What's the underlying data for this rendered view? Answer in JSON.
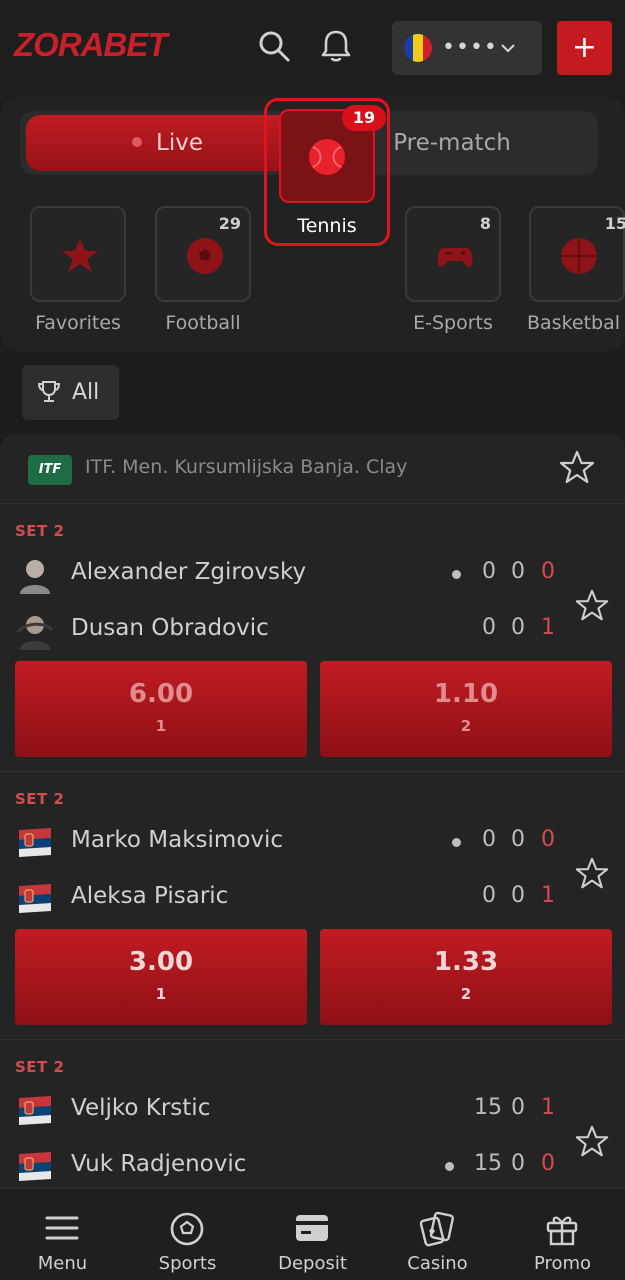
{
  "header": {
    "logo": "ZORABET",
    "balance_masked": "••••",
    "add_label": "+"
  },
  "tabs": [
    {
      "label": "Live",
      "active": true
    },
    {
      "label": "Pre-match",
      "active": false
    }
  ],
  "sports": [
    {
      "label": "Favorites",
      "count": "",
      "icon": "star-icon"
    },
    {
      "label": "Football",
      "count": "29",
      "icon": "football-icon"
    },
    {
      "label": "Tennis",
      "count": "19",
      "icon": "tennis-ball-icon",
      "selected": true
    },
    {
      "label": "E-Sports",
      "count": "8",
      "icon": "gamepad-icon"
    },
    {
      "label": "Basketbal",
      "count": "15",
      "icon": "basketball-icon"
    }
  ],
  "filter": {
    "label": "All"
  },
  "league": {
    "badge": "ITF",
    "name": "ITF. Men. Kursumlijska Banja. Clay"
  },
  "matches": [
    {
      "set": "SET 2",
      "players": [
        {
          "name": "Alexander Zgirovsky",
          "serving": true,
          "s1": "0",
          "s2": "0",
          "pts": "0"
        },
        {
          "name": "Dusan Obradovic",
          "serving": false,
          "s1": "0",
          "s2": "0",
          "pts": "1"
        }
      ],
      "odds": [
        {
          "value": "6.00",
          "label": "1"
        },
        {
          "value": "1.10",
          "label": "2"
        }
      ]
    },
    {
      "set": "SET 2",
      "players": [
        {
          "name": "Marko Maksimovic",
          "serving": true,
          "s1": "0",
          "s2": "0",
          "pts": "0"
        },
        {
          "name": "Aleksa Pisaric",
          "serving": false,
          "s1": "0",
          "s2": "0",
          "pts": "1"
        }
      ],
      "odds": [
        {
          "value": "3.00",
          "label": "1"
        },
        {
          "value": "1.33",
          "label": "2"
        }
      ]
    },
    {
      "set": "SET 2",
      "players": [
        {
          "name": "Veljko Krstic",
          "serving": false,
          "s1": "15",
          "s2": "0",
          "pts": "1"
        },
        {
          "name": "Vuk Radjenovic",
          "serving": true,
          "s1": "15",
          "s2": "0",
          "pts": "0"
        }
      ]
    }
  ],
  "bottom_nav": [
    {
      "label": "Menu",
      "icon": "hamburger-icon"
    },
    {
      "label": "Sports",
      "icon": "soccer-ball-icon"
    },
    {
      "label": "Deposit",
      "icon": "wallet-icon"
    },
    {
      "label": "Casino",
      "icon": "cards-icon"
    },
    {
      "label": "Promo",
      "icon": "gift-icon"
    }
  ],
  "colors": {
    "accent": "#c41a20",
    "background": "#1c1c1c",
    "card": "#242424"
  }
}
